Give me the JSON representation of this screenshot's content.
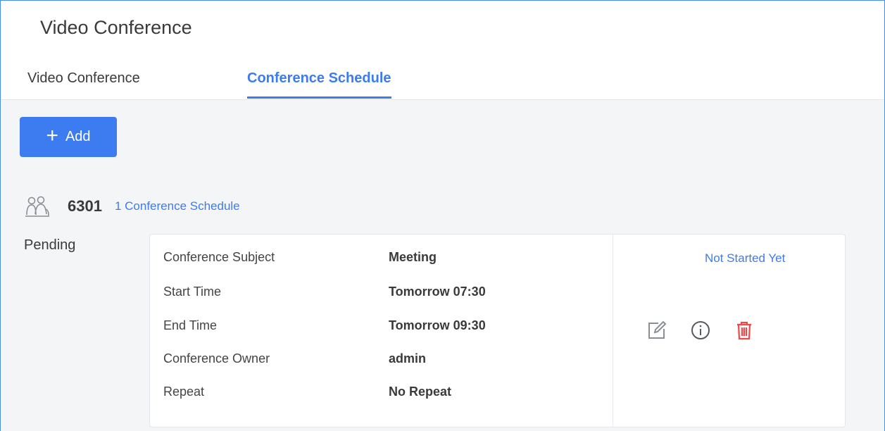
{
  "header": {
    "title": "Video Conference",
    "tabs": [
      {
        "label": "Video Conference",
        "active": false
      },
      {
        "label": "Conference Schedule",
        "active": true
      }
    ]
  },
  "toolbar": {
    "add_label": "Add",
    "add_icon": "plus-icon"
  },
  "room": {
    "icon": "conference-room-icon",
    "number": "6301",
    "schedule_count_label": "1 Conference Schedule"
  },
  "schedule_group": {
    "status_label": "Pending",
    "card": {
      "fields": [
        {
          "label": "Conference Subject",
          "value": "Meeting"
        },
        {
          "label": "Start Time",
          "value": "Tomorrow 07:30"
        },
        {
          "label": "End Time",
          "value": "Tomorrow 09:30"
        },
        {
          "label": "Conference Owner",
          "value": "admin"
        },
        {
          "label": "Repeat",
          "value": "No Repeat"
        }
      ],
      "status": "Not Started Yet",
      "actions": [
        "edit-icon",
        "info-icon",
        "delete-icon"
      ]
    }
  },
  "colors": {
    "accent": "#3d7bf0",
    "delete": "#f04848",
    "text": "#3a3a3a",
    "background": "#f4f5f7"
  }
}
